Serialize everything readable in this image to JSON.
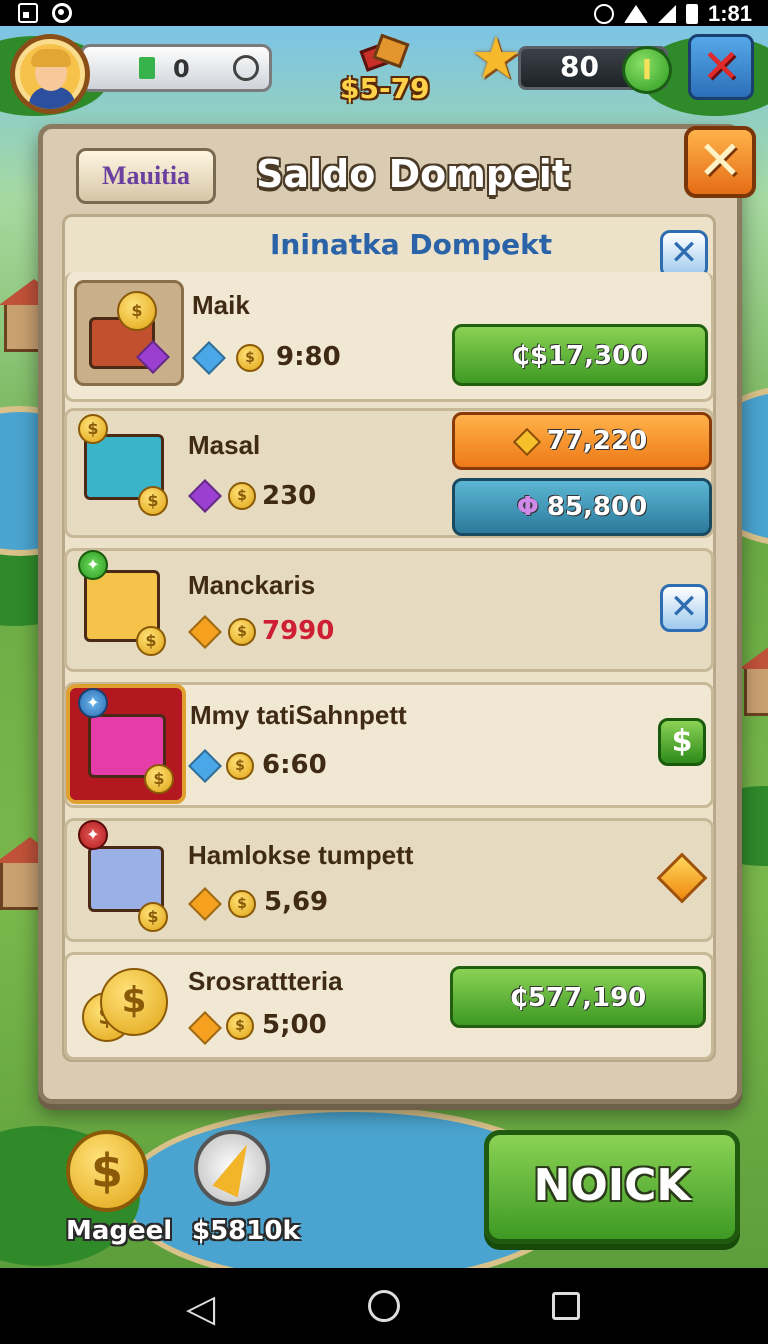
{
  "status_bar": {
    "time": "1:81"
  },
  "hud": {
    "level_value": "0",
    "money_label": "$5-79",
    "star_value": "80",
    "plus_label": "I",
    "close_label": "✕"
  },
  "dialog": {
    "tab_label": "Mauitia",
    "title": "Saldo Dompeit",
    "subtitle": "Ininatka Dompekt",
    "close_label": "✕",
    "items": [
      {
        "name": "Maik",
        "gem": "blue",
        "value": "9:80",
        "buttons": [
          "₵$17,300"
        ]
      },
      {
        "name": "Masal",
        "gem": "purple",
        "value": "230",
        "buttons": [
          "77,220",
          "85,800"
        ]
      },
      {
        "name": "Manckaris",
        "gem": "orange",
        "value": "7990",
        "value_color": "red"
      },
      {
        "name": "Mmy tatiSahnpett",
        "gem": "blue",
        "value": "6:60"
      },
      {
        "name": "Hamlokse tumpett",
        "gem": "orange",
        "value": "5,69"
      },
      {
        "name": "Srosrattteria",
        "gem": "orange",
        "value": "5;00",
        "buttons": [
          "₵577,190"
        ]
      }
    ]
  },
  "bottom": {
    "coin_label": "Mageel",
    "bolt_label": "$5810k",
    "action_label": "NOICK"
  },
  "colors": {
    "green_button": "#4caf2a",
    "orange_button": "#f28a1e",
    "teal_button": "#3a8fb0",
    "title_blue": "#2a63a8",
    "value_red": "#cf1f35"
  }
}
